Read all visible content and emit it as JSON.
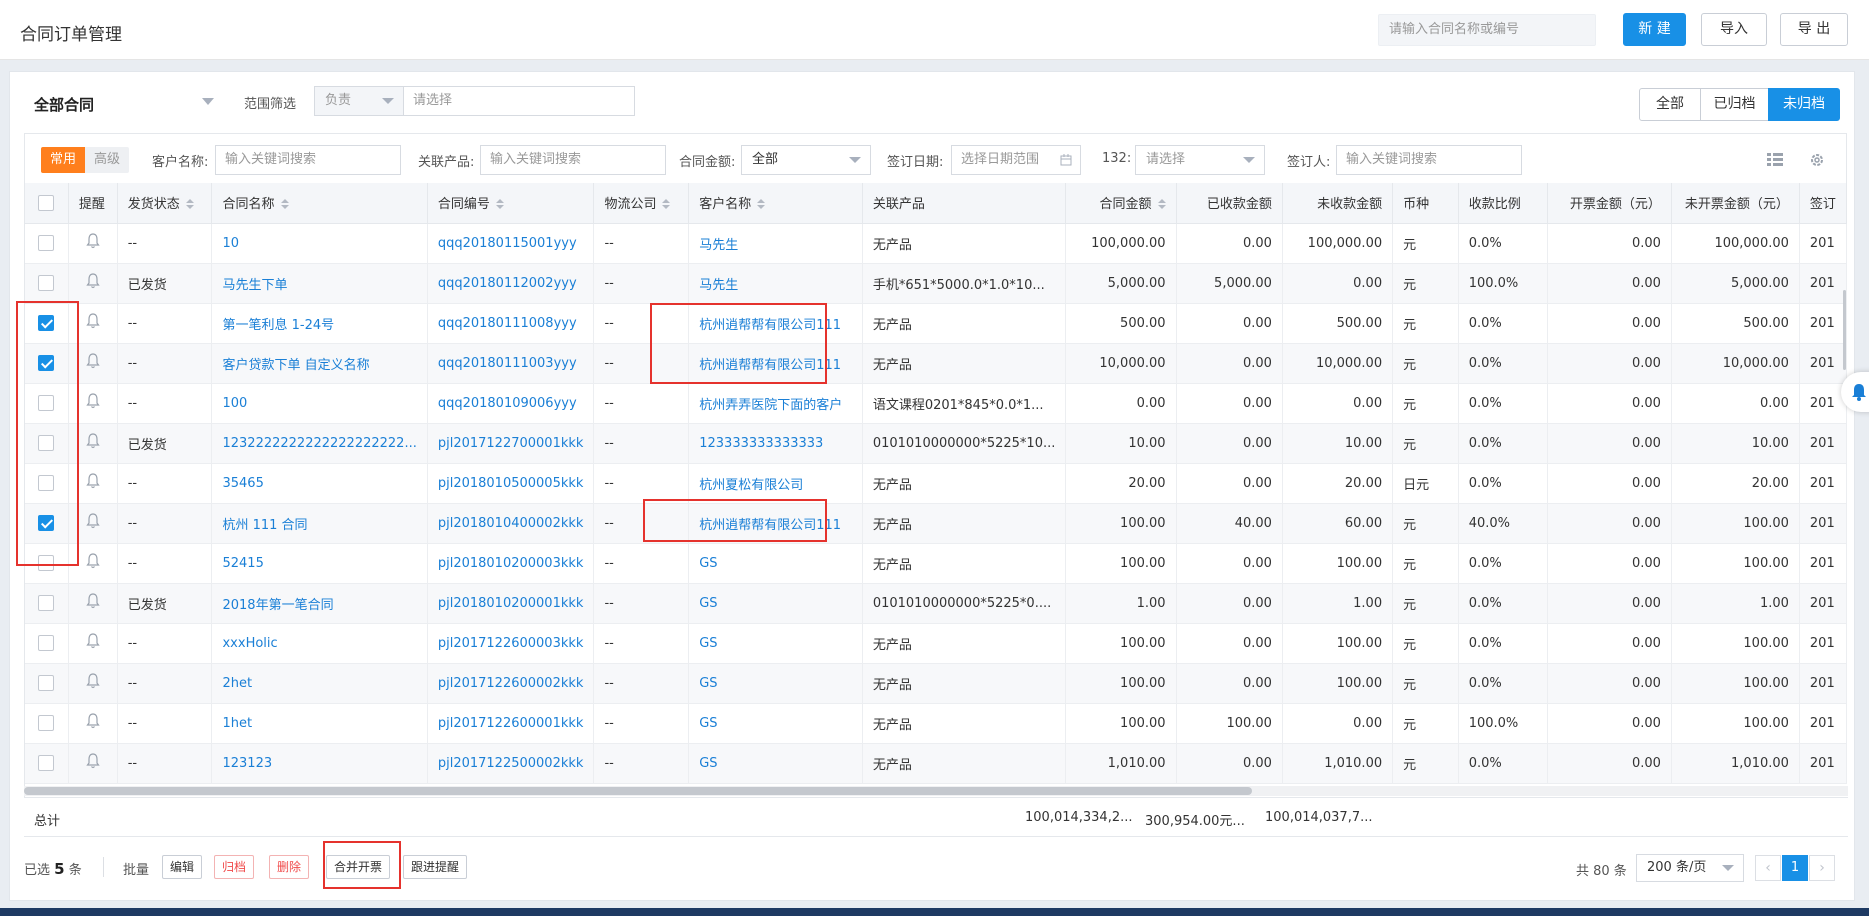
{
  "header": {
    "title": "合同订单管理",
    "search_placeholder": "请输入合同名称或编号",
    "new_label": "新 建",
    "import_label": "导入",
    "export_label": "导 出"
  },
  "toolbar": {
    "view_title": "全部合同",
    "scope_label": "范围筛选",
    "scope_select": "负责",
    "scope_placeholder": "请选择",
    "tabs": [
      "全部",
      "已归档",
      "未归档"
    ],
    "active_tab": "未归档"
  },
  "filters": {
    "common_tag": "常用",
    "advanced_tag": "高级",
    "customer_label": "客户名称:",
    "customer_placeholder": "输入关键词搜索",
    "product_label": "关联产品:",
    "product_placeholder": "输入关键词搜索",
    "amount_label": "合同金额:",
    "amount_value": "全部",
    "date_label": "签订日期:",
    "date_placeholder": "选择日期范围",
    "custom_label": "132:",
    "custom_placeholder": "请选择",
    "signer_label": "签订人:",
    "signer_placeholder": "输入关键词搜索"
  },
  "table": {
    "columns": [
      "提醒",
      "发货状态",
      "合同名称",
      "合同编号",
      "物流公司",
      "客户名称",
      "关联产品",
      "合同金额",
      "已收款金额",
      "未收款金额",
      "币种",
      "收款比例",
      "开票金额（元）",
      "未开票金额（元）",
      "签订"
    ],
    "rows": [
      {
        "checked": false,
        "ship": "--",
        "name": "10",
        "code": "qqq20180115001yyy",
        "logistics": "--",
        "customer": "马先生",
        "product": "无产品",
        "amount": "100,000.00",
        "received": "0.00",
        "unreceived": "100,000.00",
        "currency": "元",
        "ratio": "0.0%",
        "invoiced": "0.00",
        "uninvoiced": "100,000.00",
        "sign": "201"
      },
      {
        "checked": false,
        "ship": "已发货",
        "name": "马先生下单",
        "code": "qqq20180112002yyy",
        "logistics": "--",
        "customer": "马先生",
        "product": "手机*651*5000.0*1.0*10...",
        "amount": "5,000.00",
        "received": "5,000.00",
        "unreceived": "0.00",
        "currency": "元",
        "ratio": "100.0%",
        "invoiced": "0.00",
        "uninvoiced": "5,000.00",
        "sign": "201"
      },
      {
        "checked": true,
        "ship": "--",
        "name": "第一笔利息 1-24号",
        "code": "qqq20180111008yyy",
        "logistics": "--",
        "customer": "杭州逍帮帮有限公司111",
        "product": "无产品",
        "amount": "500.00",
        "received": "0.00",
        "unreceived": "500.00",
        "currency": "元",
        "ratio": "0.0%",
        "invoiced": "0.00",
        "uninvoiced": "500.00",
        "sign": "201"
      },
      {
        "checked": true,
        "ship": "--",
        "name": "客户贷款下单 自定义名称",
        "code": "qqq20180111003yyy",
        "logistics": "--",
        "customer": "杭州逍帮帮有限公司111",
        "product": "无产品",
        "amount": "10,000.00",
        "received": "0.00",
        "unreceived": "10,000.00",
        "currency": "元",
        "ratio": "0.0%",
        "invoiced": "0.00",
        "uninvoiced": "10,000.00",
        "sign": "201"
      },
      {
        "checked": false,
        "ship": "--",
        "name": "100",
        "code": "qqq20180109006yyy",
        "logistics": "--",
        "customer": "杭州弄弄医院下面的客户",
        "product": "语文课程0201*845*0.0*1...",
        "amount": "0.00",
        "received": "0.00",
        "unreceived": "0.00",
        "currency": "元",
        "ratio": "0.0%",
        "invoiced": "0.00",
        "uninvoiced": "0.00",
        "sign": "201"
      },
      {
        "checked": false,
        "ship": "已发货",
        "name": "1232222222222222222222...",
        "code": "pjl2017122700001kkk",
        "logistics": "--",
        "customer": "123333333333333",
        "product": "0101010000000*5225*10...",
        "amount": "10.00",
        "received": "0.00",
        "unreceived": "10.00",
        "currency": "元",
        "ratio": "0.0%",
        "invoiced": "0.00",
        "uninvoiced": "10.00",
        "sign": "201"
      },
      {
        "checked": false,
        "ship": "--",
        "name": "35465",
        "code": "pjl2018010500005kkk",
        "logistics": "--",
        "customer": "杭州夏松有限公司",
        "product": "无产品",
        "amount": "20.00",
        "received": "0.00",
        "unreceived": "20.00",
        "currency": "日元",
        "ratio": "0.0%",
        "invoiced": "0.00",
        "uninvoiced": "20.00",
        "sign": "201"
      },
      {
        "checked": true,
        "ship": "--",
        "name": "杭州 111 合同",
        "code": "pjl2018010400002kkk",
        "logistics": "--",
        "customer": "杭州逍帮帮有限公司111",
        "product": "无产品",
        "amount": "100.00",
        "received": "40.00",
        "unreceived": "60.00",
        "currency": "元",
        "ratio": "40.0%",
        "invoiced": "0.00",
        "uninvoiced": "100.00",
        "sign": "201"
      },
      {
        "checked": false,
        "ship": "--",
        "name": "52415",
        "code": "pjl2018010200003kkk",
        "logistics": "--",
        "customer": "GS",
        "product": "无产品",
        "amount": "100.00",
        "received": "0.00",
        "unreceived": "100.00",
        "currency": "元",
        "ratio": "0.0%",
        "invoiced": "0.00",
        "uninvoiced": "100.00",
        "sign": "201"
      },
      {
        "checked": false,
        "ship": "已发货",
        "name": "2018年第一笔合同",
        "code": "pjl2018010200001kkk",
        "logistics": "--",
        "customer": "GS",
        "product": "0101010000000*5225*0....",
        "amount": "1.00",
        "received": "0.00",
        "unreceived": "1.00",
        "currency": "元",
        "ratio": "0.0%",
        "invoiced": "0.00",
        "uninvoiced": "1.00",
        "sign": "201"
      },
      {
        "checked": false,
        "ship": "--",
        "name": "xxxHolic",
        "code": "pjl2017122600003kkk",
        "logistics": "--",
        "customer": "GS",
        "product": "无产品",
        "amount": "100.00",
        "received": "0.00",
        "unreceived": "100.00",
        "currency": "元",
        "ratio": "0.0%",
        "invoiced": "0.00",
        "uninvoiced": "100.00",
        "sign": "201"
      },
      {
        "checked": false,
        "ship": "--",
        "name": "2het",
        "code": "pjl2017122600002kkk",
        "logistics": "--",
        "customer": "GS",
        "product": "无产品",
        "amount": "100.00",
        "received": "0.00",
        "unreceived": "100.00",
        "currency": "元",
        "ratio": "0.0%",
        "invoiced": "0.00",
        "uninvoiced": "100.00",
        "sign": "201"
      },
      {
        "checked": false,
        "ship": "--",
        "name": "1het",
        "code": "pjl2017122600001kkk",
        "logistics": "--",
        "customer": "GS",
        "product": "无产品",
        "amount": "100.00",
        "received": "100.00",
        "unreceived": "0.00",
        "currency": "元",
        "ratio": "100.0%",
        "invoiced": "0.00",
        "uninvoiced": "100.00",
        "sign": "201"
      },
      {
        "checked": false,
        "ship": "--",
        "name": "123123",
        "code": "pjl2017122500002kkk",
        "logistics": "--",
        "customer": "GS",
        "product": "无产品",
        "amount": "1,010.00",
        "received": "0.00",
        "unreceived": "1,010.00",
        "currency": "元",
        "ratio": "0.0%",
        "invoiced": "0.00",
        "uninvoiced": "1,010.00",
        "sign": "201"
      }
    ],
    "total_label": "总计",
    "total_amount": "100,014,334,2...",
    "total_received": "300,954.00元...",
    "total_unreceived": "100,014,037,7..."
  },
  "footer": {
    "selected_prefix": "已选",
    "selected_count": "5",
    "selected_suffix": "条",
    "batch_label": "批量",
    "edit_label": "编辑",
    "archive_label": "归档",
    "delete_label": "删除",
    "merge_invoice_label": "合并开票",
    "follow_label": "跟进提醒",
    "total_text": "共 80 条",
    "page_size": "200 条/页",
    "current_page": "1"
  },
  "colors": {
    "primary": "#1890e6",
    "accent_orange": "#ff7f1d",
    "highlight_red": "#e5322d",
    "link": "#1a7fd6"
  }
}
